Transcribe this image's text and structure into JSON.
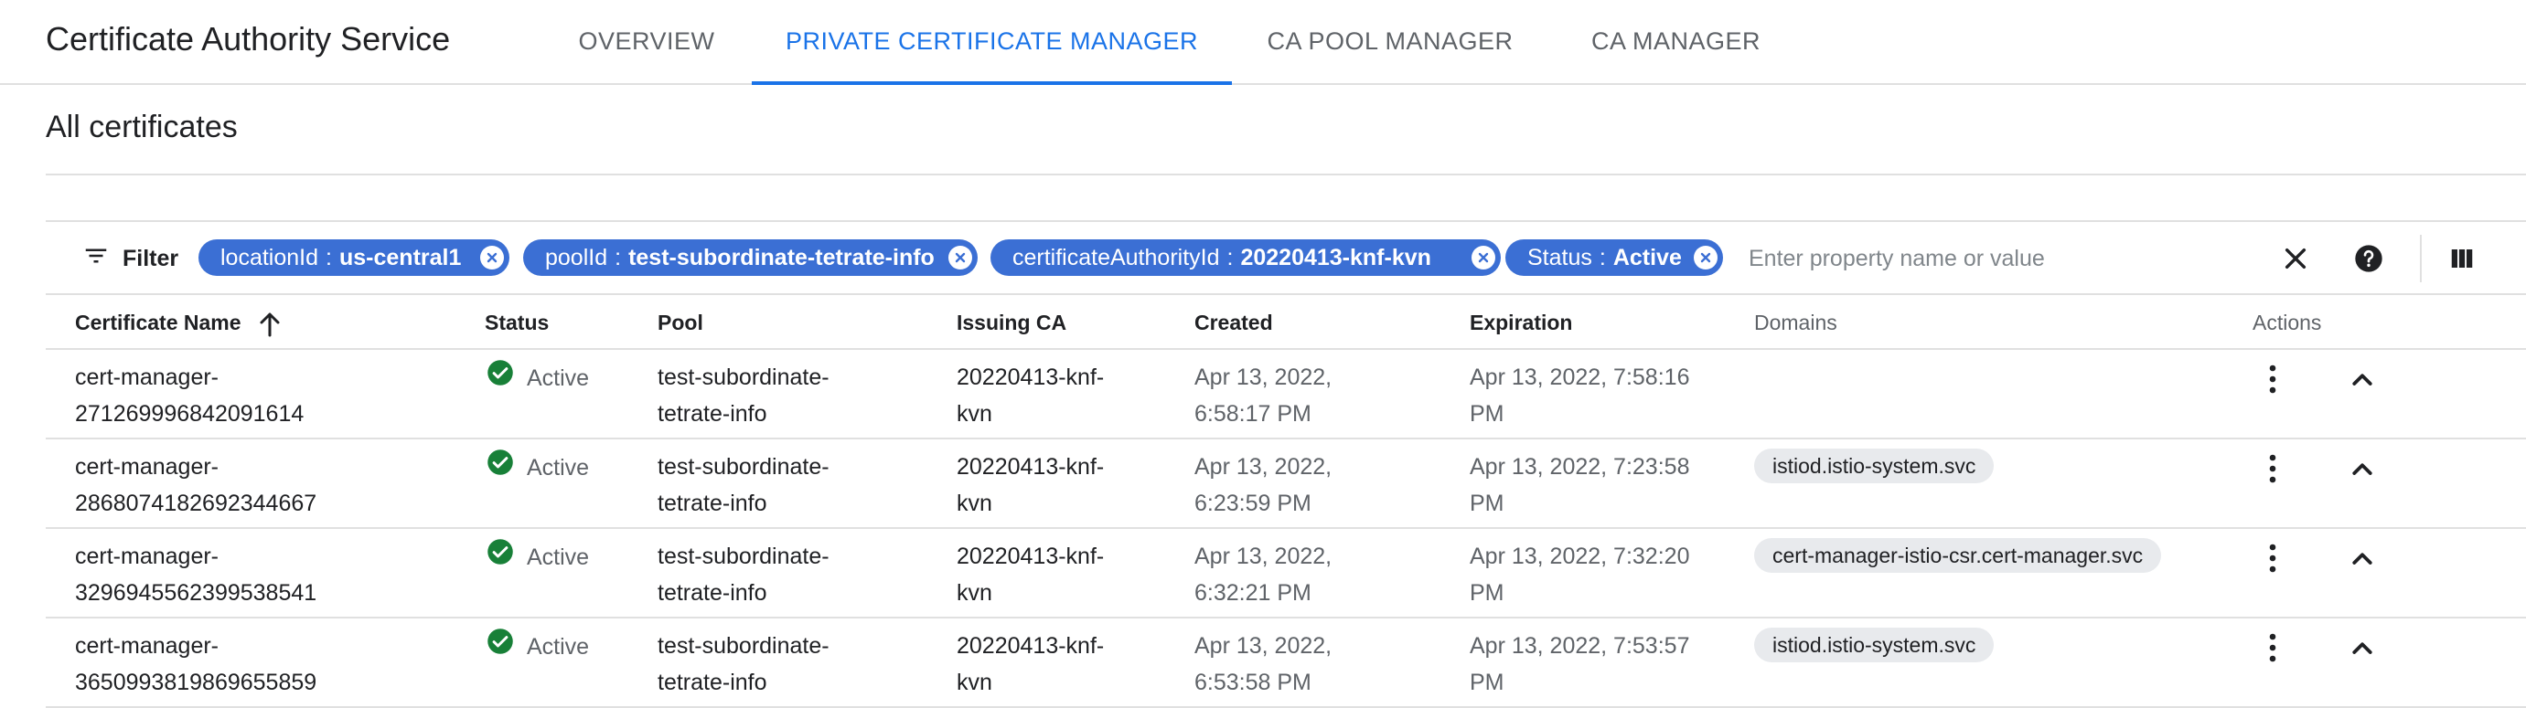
{
  "app": {
    "title": "Certificate Authority Service",
    "tabs": [
      {
        "label": "OVERVIEW",
        "active": false
      },
      {
        "label": "PRIVATE CERTIFICATE MANAGER",
        "active": true
      },
      {
        "label": "CA POOL MANAGER",
        "active": false
      },
      {
        "label": "CA MANAGER",
        "active": false
      }
    ]
  },
  "page": {
    "title": "All certificates"
  },
  "filter": {
    "label": "Filter",
    "chips": [
      {
        "key": "locationId",
        "sep": ":",
        "value": "us-central1"
      },
      {
        "key": "poolId",
        "sep": ":",
        "value": "test-subordinate-tetrate-info"
      },
      {
        "key": "certificateAuthorityId",
        "sep": ":",
        "value": "20220413-knf-kvn"
      },
      {
        "key": "Status",
        "sep": ":",
        "value": "Active"
      }
    ],
    "placeholder": "Enter property name or value",
    "value": "",
    "icons": [
      "filter-icon",
      "chip-remove-icon",
      "clear-icon",
      "help-icon",
      "columns-icon"
    ]
  },
  "table": {
    "columns": {
      "name": "Certificate Name",
      "status": "Status",
      "pool": "Pool",
      "issuing_ca": "Issuing CA",
      "created": "Created",
      "expiration": "Expiration",
      "domains": "Domains",
      "actions": "Actions"
    },
    "sort": {
      "column": "Certificate Name",
      "direction": "ascending",
      "icon": "arrow-up-icon"
    },
    "rows": [
      {
        "name_l1": "cert-manager-",
        "name_l2": "271269996842091614",
        "status": "Active",
        "pool_l1": "test-subordinate-",
        "pool_l2": "tetrate-info",
        "ca_l1": "20220413-knf-",
        "ca_l2": "kvn",
        "created_l1": "Apr 13, 2022,",
        "created_l2": "6:58:17 PM",
        "exp_l1": "Apr 13, 2022, 7:58:16",
        "exp_l2": "PM",
        "domain": ""
      },
      {
        "name_l1": "cert-manager-",
        "name_l2": "2868074182692344667",
        "status": "Active",
        "pool_l1": "test-subordinate-",
        "pool_l2": "tetrate-info",
        "ca_l1": "20220413-knf-",
        "ca_l2": "kvn",
        "created_l1": "Apr 13, 2022,",
        "created_l2": "6:23:59 PM",
        "exp_l1": "Apr 13, 2022, 7:23:58",
        "exp_l2": "PM",
        "domain": "istiod.istio-system.svc"
      },
      {
        "name_l1": "cert-manager-",
        "name_l2": "3296945562399538541",
        "status": "Active",
        "pool_l1": "test-subordinate-",
        "pool_l2": "tetrate-info",
        "ca_l1": "20220413-knf-",
        "ca_l2": "kvn",
        "created_l1": "Apr 13, 2022,",
        "created_l2": "6:32:21 PM",
        "exp_l1": "Apr 13, 2022, 7:32:20",
        "exp_l2": "PM",
        "domain": "cert-manager-istio-csr.cert-manager.svc"
      },
      {
        "name_l1": "cert-manager-",
        "name_l2": "3650993819869655859",
        "status": "Active",
        "pool_l1": "test-subordinate-",
        "pool_l2": "tetrate-info",
        "ca_l1": "20220413-knf-",
        "ca_l2": "kvn",
        "created_l1": "Apr 13, 2022,",
        "created_l2": "6:53:58 PM",
        "exp_l1": "Apr 13, 2022, 7:53:57",
        "exp_l2": "PM",
        "domain": "istiod.istio-system.svc"
      }
    ],
    "row_icons": [
      "more-vert-icon",
      "chevron-up-icon"
    ]
  },
  "colors": {
    "accent": "#1a73e8",
    "chip": "#3b6fd4",
    "status_active": "#188038",
    "divider": "#e0e0e0",
    "domain_chip": "#e8eaed"
  }
}
